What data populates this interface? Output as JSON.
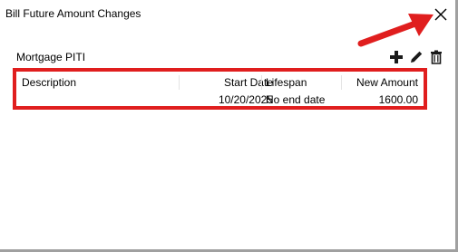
{
  "window": {
    "title": "Bill Future Amount Changes"
  },
  "bill": {
    "name": "Mortgage PITI"
  },
  "toolbar": {
    "add_icon": "plus-icon",
    "edit_icon": "pencil-icon",
    "delete_icon": "trash-icon"
  },
  "table": {
    "columns": [
      "Description",
      "Start Date",
      "Lifespan",
      "New Amount"
    ],
    "rows": [
      {
        "description": "",
        "start_date": "10/20/2025",
        "lifespan": "No end date",
        "new_amount": "1600.00"
      }
    ]
  },
  "colors": {
    "highlight": "#e01e1e",
    "annotation_arrow": "#e01e1e"
  }
}
